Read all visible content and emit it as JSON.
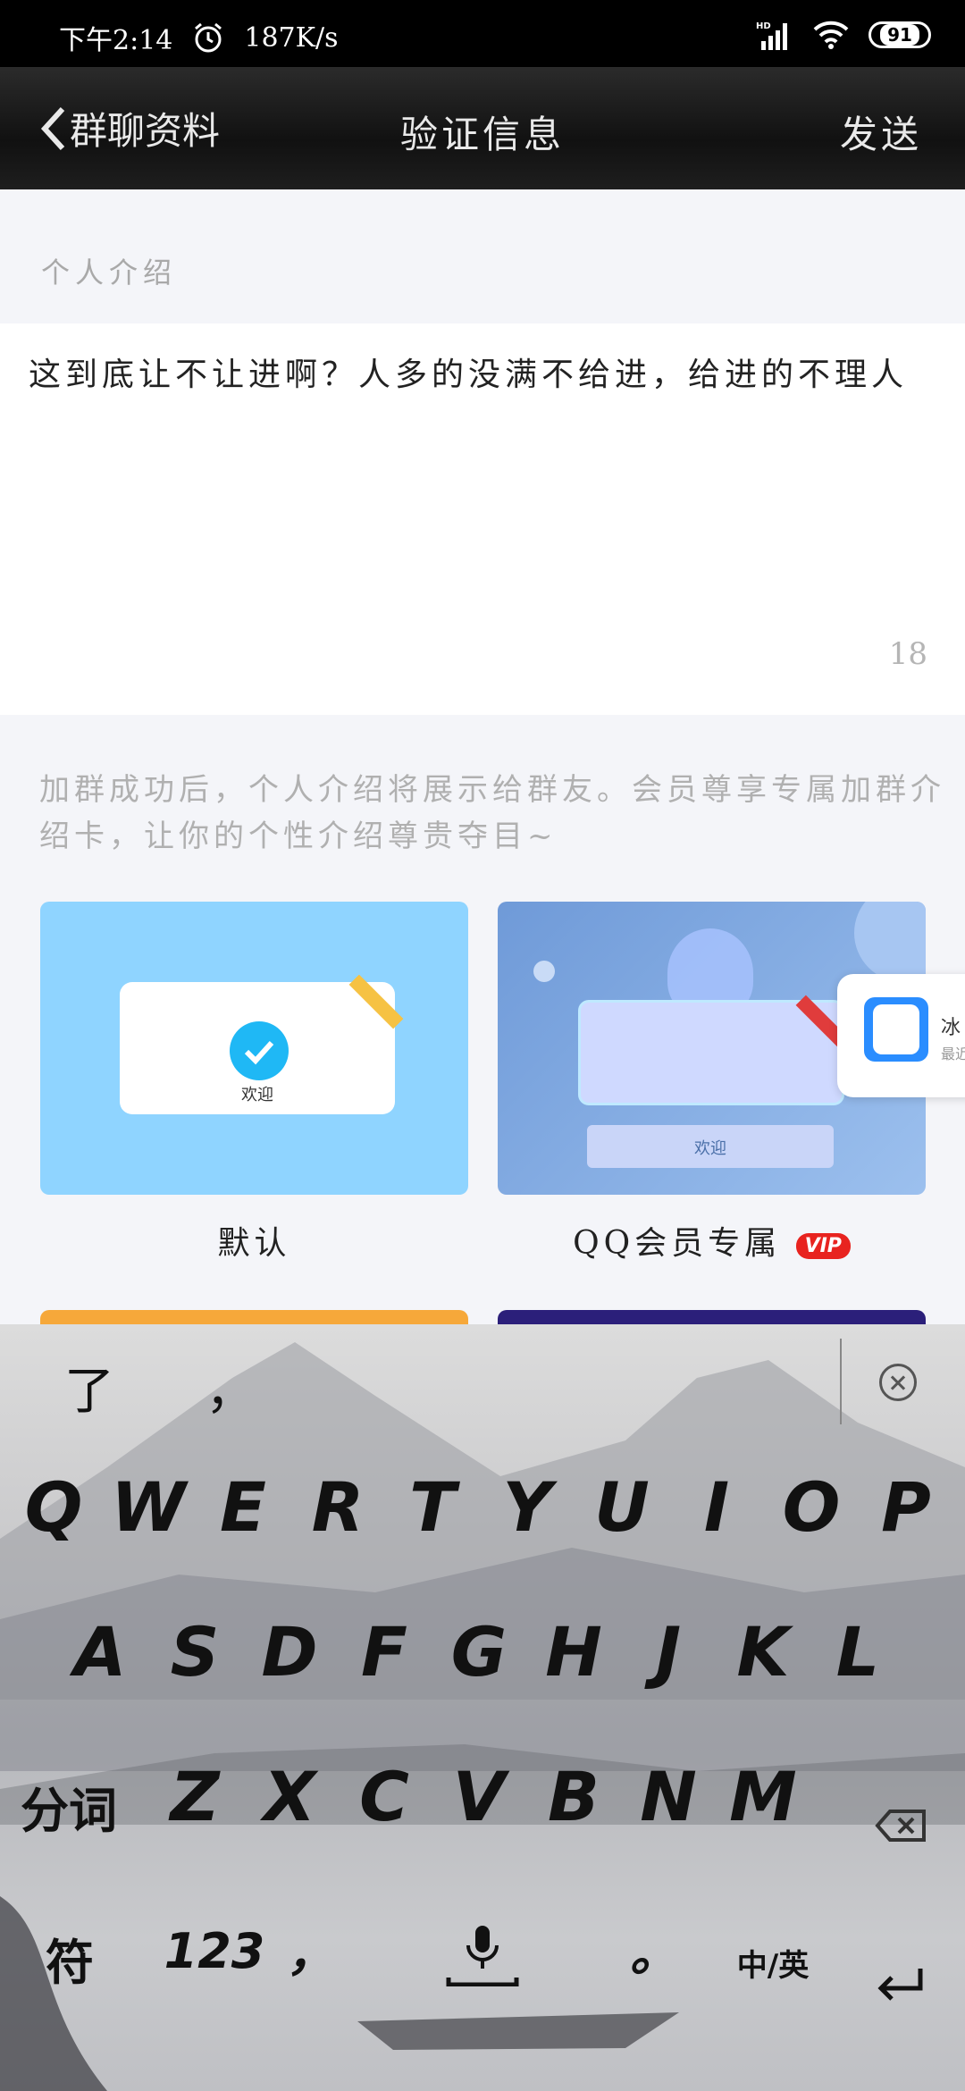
{
  "status": {
    "time": "下午2:14",
    "speed": "187K/s",
    "network": "HD",
    "battery": "91"
  },
  "nav": {
    "back_label": "群聊资料",
    "title": "验证信息",
    "send_label": "发送"
  },
  "intro": {
    "section_label": "个人介绍",
    "text": "这到底让不让进啊？人多的没满不给进，给进的不理人",
    "count": "18"
  },
  "tip": "加群成功后，个人介绍将展示给群友。会员尊享专属加群介绍卡，让你的个性介绍尊贵夺目~",
  "cards": [
    {
      "label": "默认",
      "preview_text": "欢迎"
    },
    {
      "label": "QQ会员专属",
      "badge": "VIP",
      "preview_text": "欢迎"
    }
  ],
  "float_widget": {
    "line1": "冰",
    "line2": "最近"
  },
  "keyboard": {
    "candidates": [
      "了",
      "，"
    ],
    "row1": [
      "Q",
      "W",
      "E",
      "R",
      "T",
      "Y",
      "U",
      "I",
      "O",
      "P"
    ],
    "row2": [
      "A",
      "S",
      "D",
      "F",
      "G",
      "H",
      "J",
      "K",
      "L"
    ],
    "row3_left": "分词",
    "row3": [
      "Z",
      "X",
      "C",
      "V",
      "B",
      "N",
      "M"
    ],
    "row4": {
      "left": "符",
      "num": "123",
      "comma": "，",
      "period": "。",
      "lang": "中/英"
    }
  }
}
